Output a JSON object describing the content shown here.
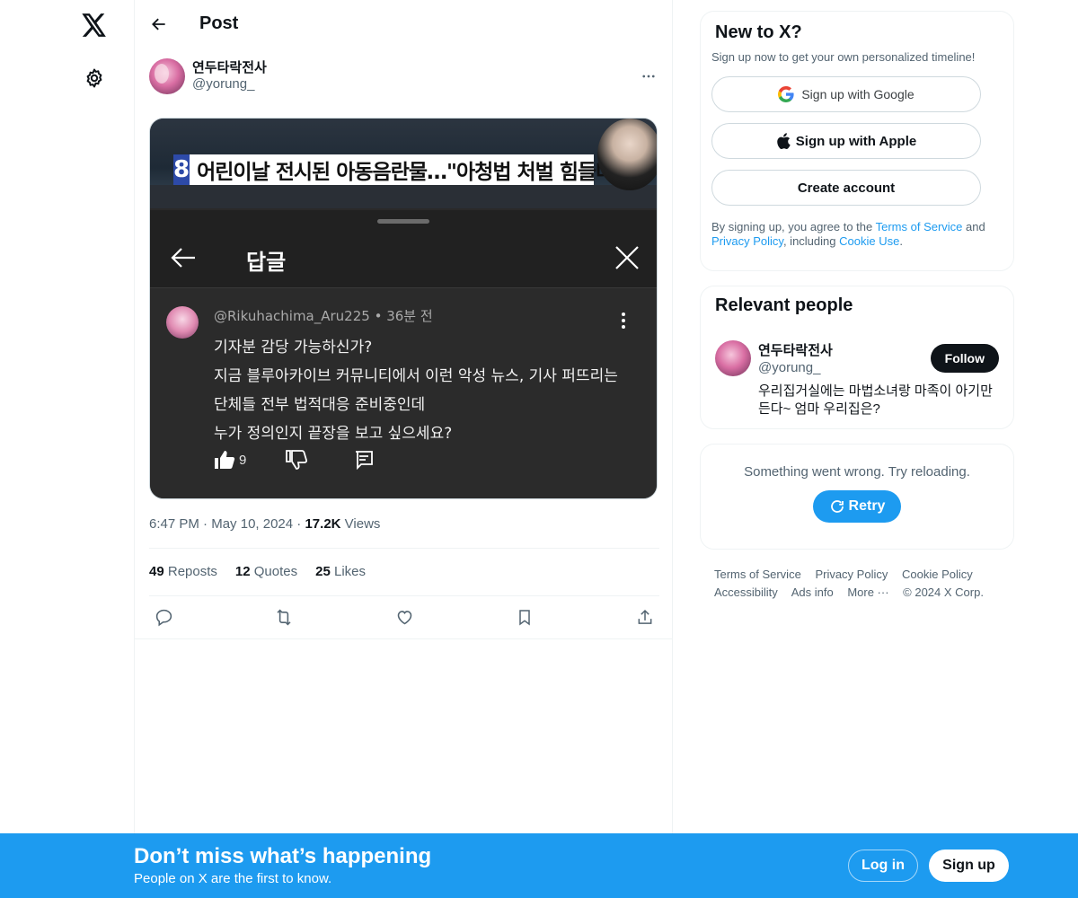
{
  "nav": {
    "logo_icon": "x-logo-icon",
    "settings_icon": "gear-icon"
  },
  "header": {
    "title": "Post",
    "back_icon": "arrow-left-icon"
  },
  "post": {
    "author_name": "연두타락전사",
    "author_handle": "@yorung_",
    "timestamp_time": "6:47 PM",
    "timestamp_date": "May 10, 2024",
    "views_count": "17.2K",
    "views_label": "Views",
    "reposts_count": "49",
    "reposts_label": "Reposts",
    "quotes_count": "12",
    "quotes_label": "Quotes",
    "likes_count": "25",
    "likes_label": "Likes"
  },
  "media": {
    "news_number": "8",
    "news_headline": "어린이날 전시된 아동음란물…\"아청법 처벌 힘들다\"",
    "sheet_title": "답글",
    "comment_user": "@Rikuhachima_Aru225 • 36분 전",
    "comment_lines": [
      "기자분 감당 가능하신가?",
      "지금 블루아카이브 커뮤니티에서 이런 악성 뉴스, 기사 퍼뜨리는",
      "단체들 전부 법적대응 준비중인데",
      "누가 정의인지 끝장을 보고 싶으세요?"
    ],
    "comment_likes": "9"
  },
  "signup_card": {
    "title": "New to X?",
    "subtitle": "Sign up now to get your own personalized timeline!",
    "google_label": "Sign up with Google",
    "apple_label": "Sign up with Apple",
    "create_label": "Create account",
    "legal_prefix": "By signing up, you agree to the ",
    "terms_link": "Terms of Service",
    "legal_and": " and ",
    "privacy_link": "Privacy Policy",
    "legal_including": ", including ",
    "cookie_link": "Cookie Use",
    "legal_end": "."
  },
  "people_card": {
    "title": "Relevant people",
    "name": "연두타락전사",
    "handle": "@yorung_",
    "bio": "우리집거실에는 마법소녀랑 마족이 아기만든다~ 엄마 우리집은?",
    "follow_label": "Follow"
  },
  "error_card": {
    "message": "Something went wrong. Try reloading.",
    "retry_label": "Retry"
  },
  "footer": {
    "links": [
      "Terms of Service",
      "Privacy Policy",
      "Cookie Policy",
      "Accessibility",
      "Ads info",
      "More ···"
    ],
    "copyright": "© 2024 X Corp."
  },
  "banner": {
    "title": "Don’t miss what’s happening",
    "subtitle": "People on X are the first to know.",
    "login_label": "Log in",
    "signup_label": "Sign up"
  },
  "colors": {
    "accent": "#1d9bf0",
    "text": "#0f1419",
    "muted": "#536471"
  }
}
